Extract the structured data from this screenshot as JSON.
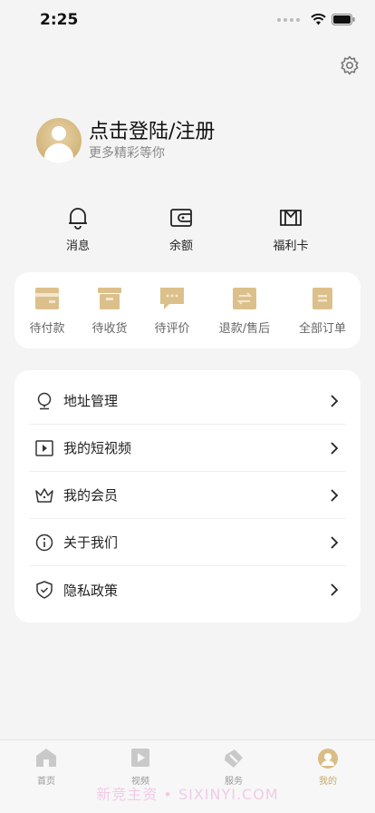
{
  "status": {
    "time": "2:25"
  },
  "profile": {
    "title": "点击登陆/注册",
    "subtitle": "更多精彩等你"
  },
  "quick": [
    {
      "label": "消息",
      "icon": "bell-icon"
    },
    {
      "label": "余额",
      "icon": "wallet-icon"
    },
    {
      "label": "福利卡",
      "icon": "card-icon"
    }
  ],
  "orders": [
    {
      "label": "待付款",
      "icon": "payment-icon"
    },
    {
      "label": "待收货",
      "icon": "box-icon"
    },
    {
      "label": "待评价",
      "icon": "comment-icon"
    },
    {
      "label": "退款/售后",
      "icon": "refund-icon"
    },
    {
      "label": "全部订单",
      "icon": "list-icon"
    }
  ],
  "menu": [
    {
      "label": "地址管理",
      "icon": "location-icon"
    },
    {
      "label": "我的短视频",
      "icon": "video-icon"
    },
    {
      "label": "我的会员",
      "icon": "crown-icon"
    },
    {
      "label": "关于我们",
      "icon": "info-icon"
    },
    {
      "label": "隐私政策",
      "icon": "shield-icon"
    }
  ],
  "tabbar": [
    {
      "label": "首页",
      "icon": "home-icon"
    },
    {
      "label": "视频",
      "icon": "video-icon"
    },
    {
      "label": "服务",
      "icon": "service-icon"
    },
    {
      "label": "我的",
      "icon": "user-icon",
      "active": true
    }
  ],
  "watermark": "新竞主资 • SIXINYI.COM",
  "colors": {
    "accent": "#c9a868",
    "background": "#f4f4f4"
  }
}
